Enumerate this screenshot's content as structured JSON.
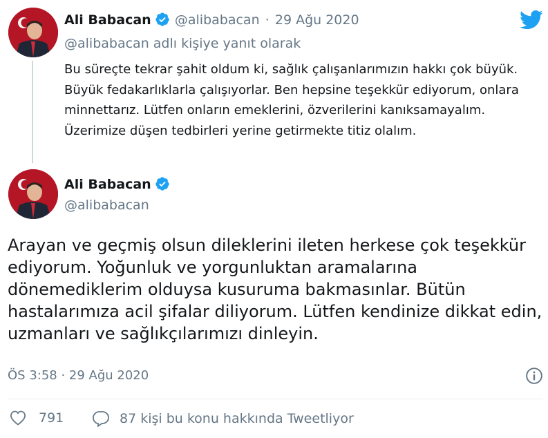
{
  "parent_tweet": {
    "author_name": "Ali Babacan",
    "author_handle": "@alibabacan",
    "separator": "·",
    "date": "29 Ağu 2020",
    "reply_to": "@alibabacan adlı kişiye yanıt olarak",
    "text": "Bu süreçte tekrar şahit oldum ki, sağlık çalışanlarımızın hakkı çok büyük. Büyük fedakarlıklarla çalışıyorlar. Ben hepsine teşekkür ediyorum, onlara minnettarız. Lütfen onların emeklerini, özverilerini kanıksamayalım. Üzerimize düşen tedbirleri yerine getirmekte titiz olalım."
  },
  "main_tweet": {
    "author_name": "Ali Babacan",
    "author_handle": "@alibabacan",
    "text": "Arayan ve geçmiş olsun dileklerini ileten herkese çok teşekkür ediyorum. Yoğunluk ve yorgunluktan aramalarına dönemediklerim olduysa kusuruma bakmasınlar. Bütün hastalarımıza acil şifalar diliyorum. Lütfen kendinize dikkat edin, uzmanları ve sağlıkçılarımızı dinleyin.",
    "timestamp": "ÖS 3:58 · 29 Ağu 2020"
  },
  "actions": {
    "likes": "791",
    "replies_label": "87 kişi bu konu hakkında Tweetliyor"
  },
  "colors": {
    "twitter_blue": "#1da1f2",
    "text": "#14171a",
    "secondary": "#657786",
    "divider": "#e6ecf0"
  },
  "icons": {
    "brand": "twitter-bird-icon",
    "verified": "verified-badge-icon",
    "info": "info-icon",
    "like": "heart-icon",
    "reply": "speech-bubble-icon"
  }
}
